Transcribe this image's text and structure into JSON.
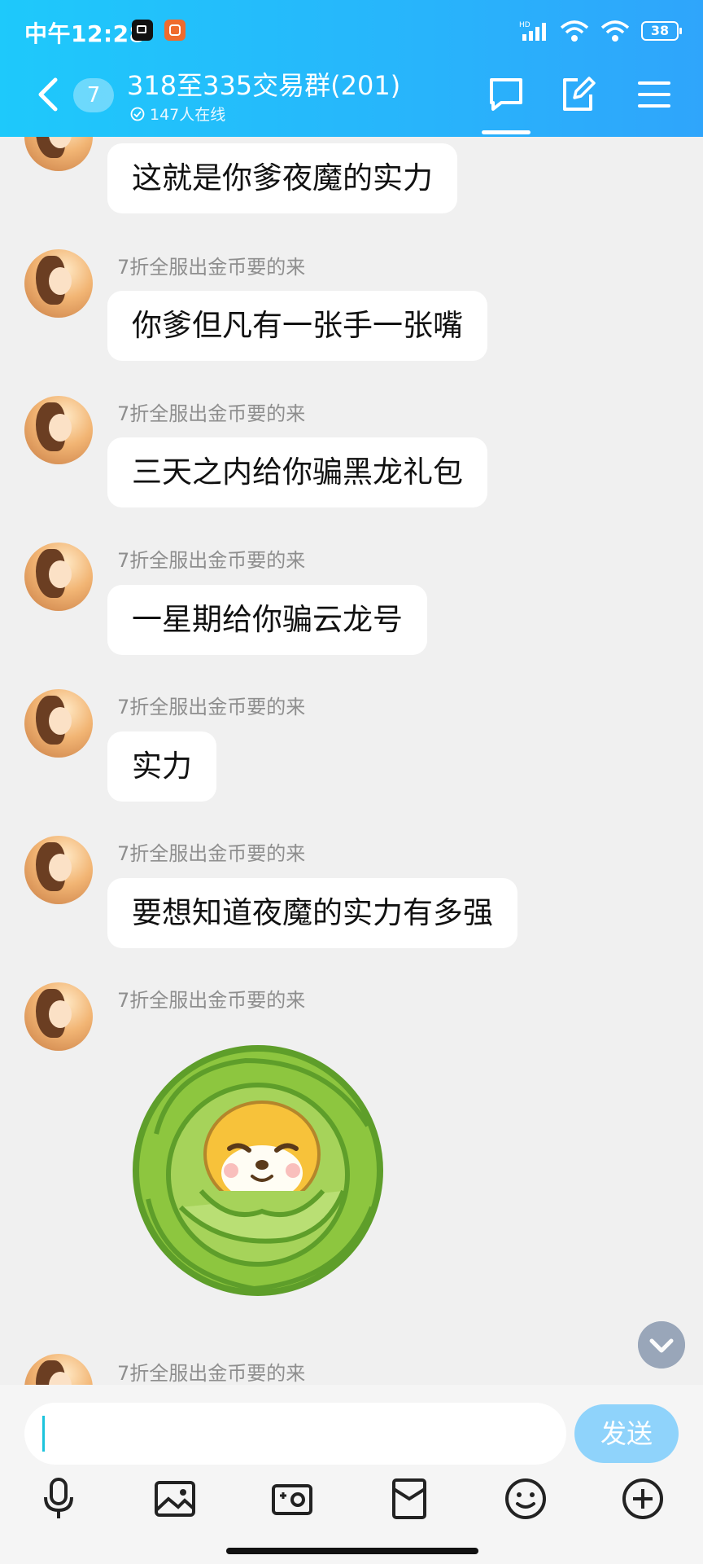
{
  "status_bar": {
    "time": "中午12:28",
    "battery": "38"
  },
  "header": {
    "unread_badge": "7",
    "title": "318至335交易群(201)",
    "online": "147人在线"
  },
  "messages": [
    {
      "sender": "",
      "text": "这就是你爹夜魔的实力"
    },
    {
      "sender": "7折全服出金币要的来",
      "text": "你爹但凡有一张手一张嘴"
    },
    {
      "sender": "7折全服出金币要的来",
      "text": "三天之内给你骗黑龙礼包"
    },
    {
      "sender": "7折全服出金币要的来",
      "text": "一星期给你骗云龙号"
    },
    {
      "sender": "7折全服出金币要的来",
      "text": "实力"
    },
    {
      "sender": "7折全服出金币要的来",
      "text": "要想知道夜魔的实力有多强"
    },
    {
      "sender": "7折全服出金币要的来",
      "sticker": "cabbage-shiba-sticker"
    },
    {
      "sender": "7折全服出金币要的来"
    }
  ],
  "input": {
    "value": "",
    "send_label": "发送"
  },
  "toolbar": [
    "microphone-icon",
    "image-icon",
    "camera-icon",
    "red-packet-icon",
    "emoji-icon",
    "plus-icon"
  ],
  "colors": {
    "header_start": "#1ec9fb",
    "header_end": "#2fa5fb",
    "send_button": "#8fd3fb",
    "background": "#f0f0f0"
  }
}
